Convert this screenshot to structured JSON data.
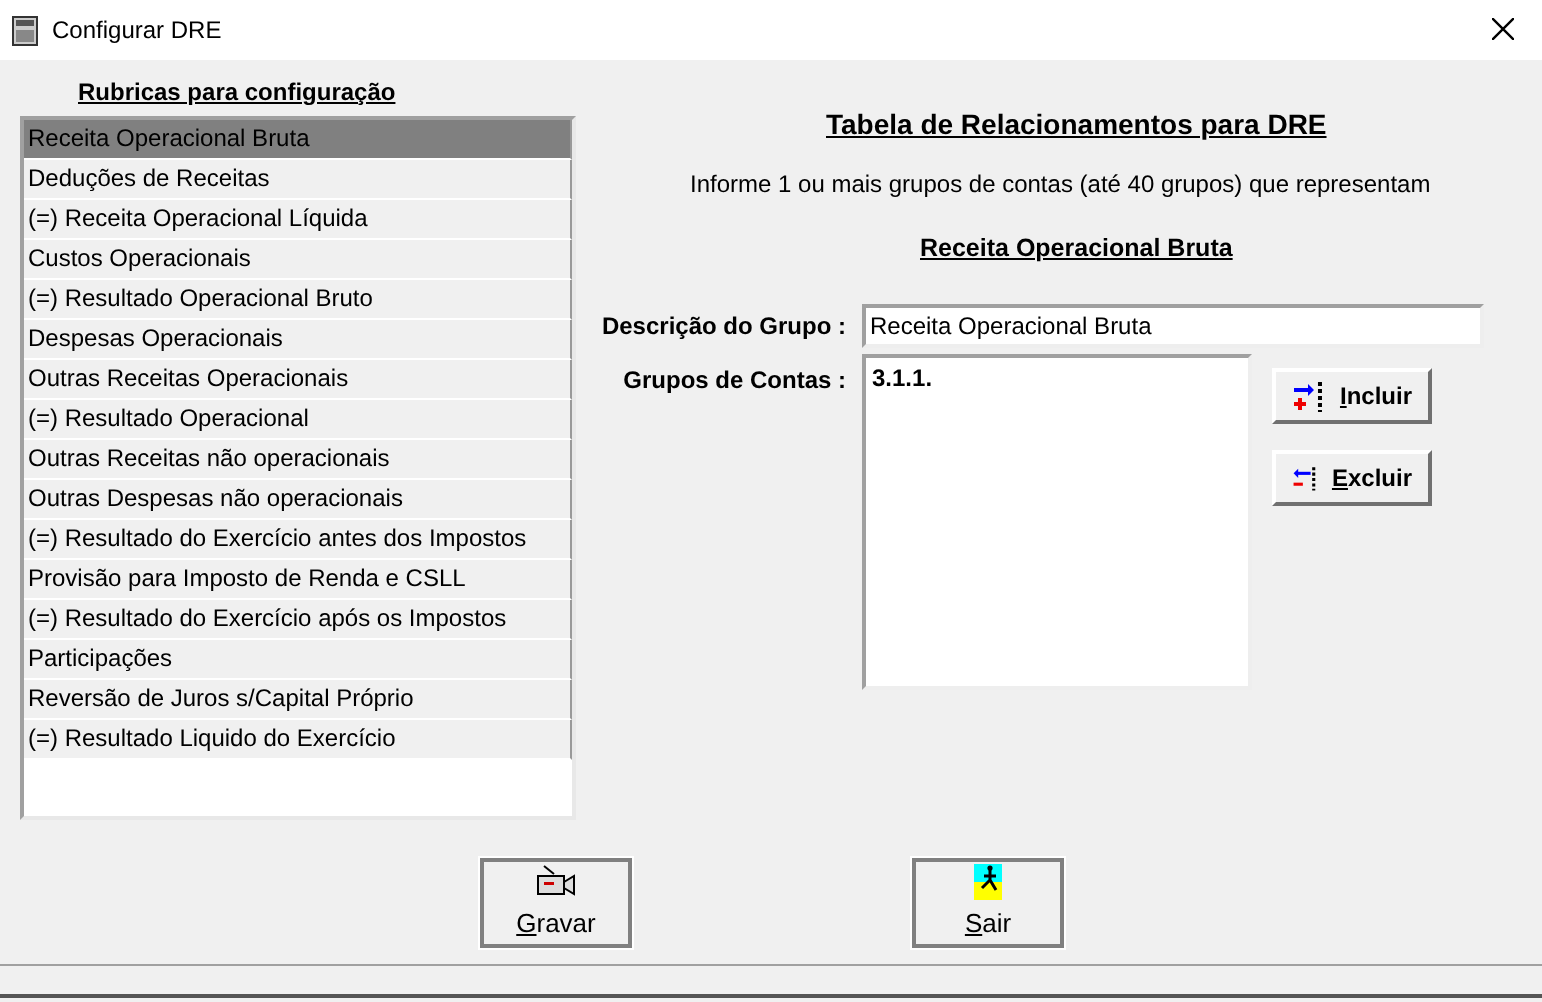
{
  "window": {
    "title": "Configurar DRE"
  },
  "rubricas": {
    "heading": "Rubricas  para configuração",
    "items": [
      {
        "label": "Receita Operacional Bruta",
        "selected": true
      },
      {
        "label": "Deduções de Receitas",
        "selected": false
      },
      {
        "label": "(=) Receita Operacional Líquida",
        "selected": false
      },
      {
        "label": "Custos Operacionais",
        "selected": false
      },
      {
        "label": "(=) Resultado Operacional Bruto",
        "selected": false
      },
      {
        "label": "Despesas Operacionais",
        "selected": false
      },
      {
        "label": "Outras Receitas Operacionais",
        "selected": false
      },
      {
        "label": "(=) Resultado Operacional",
        "selected": false
      },
      {
        "label": "Outras Receitas não operacionais",
        "selected": false
      },
      {
        "label": "Outras Despesas não operacionais",
        "selected": false
      },
      {
        "label": "(=) Resultado do Exercício antes dos Impostos",
        "selected": false
      },
      {
        "label": "Provisão para Imposto de Renda e CSLL",
        "selected": false
      },
      {
        "label": "(=) Resultado do Exercício após os Impostos",
        "selected": false
      },
      {
        "label": "Participações",
        "selected": false
      },
      {
        "label": "Reversão de Juros s/Capital Próprio",
        "selected": false
      },
      {
        "label": "(=) Resultado Liquido do Exercício",
        "selected": false
      }
    ]
  },
  "panel": {
    "title": "Tabela de Relacionamentos para DRE",
    "instruction": "Informe 1 ou mais grupos de contas (até 40 grupos) que representam",
    "rubrica": "Receita Operacional Bruta",
    "descricao": {
      "label": "Descrição do Grupo :",
      "value": "Receita Operacional Bruta"
    },
    "grupos": {
      "label": "Grupos de Contas :",
      "items": [
        "3.1.1."
      ]
    },
    "buttons": [
      {
        "kind": "add",
        "label": "Incluir",
        "mnemonic_first": true
      },
      {
        "kind": "remove",
        "label": "Excluir",
        "mnemonic_first": true
      }
    ]
  },
  "footer_buttons": [
    {
      "kind": "save",
      "label": "Gravar",
      "mnemonic_first": true
    },
    {
      "kind": "exit",
      "label": "Sair",
      "mnemonic_first": true
    }
  ]
}
